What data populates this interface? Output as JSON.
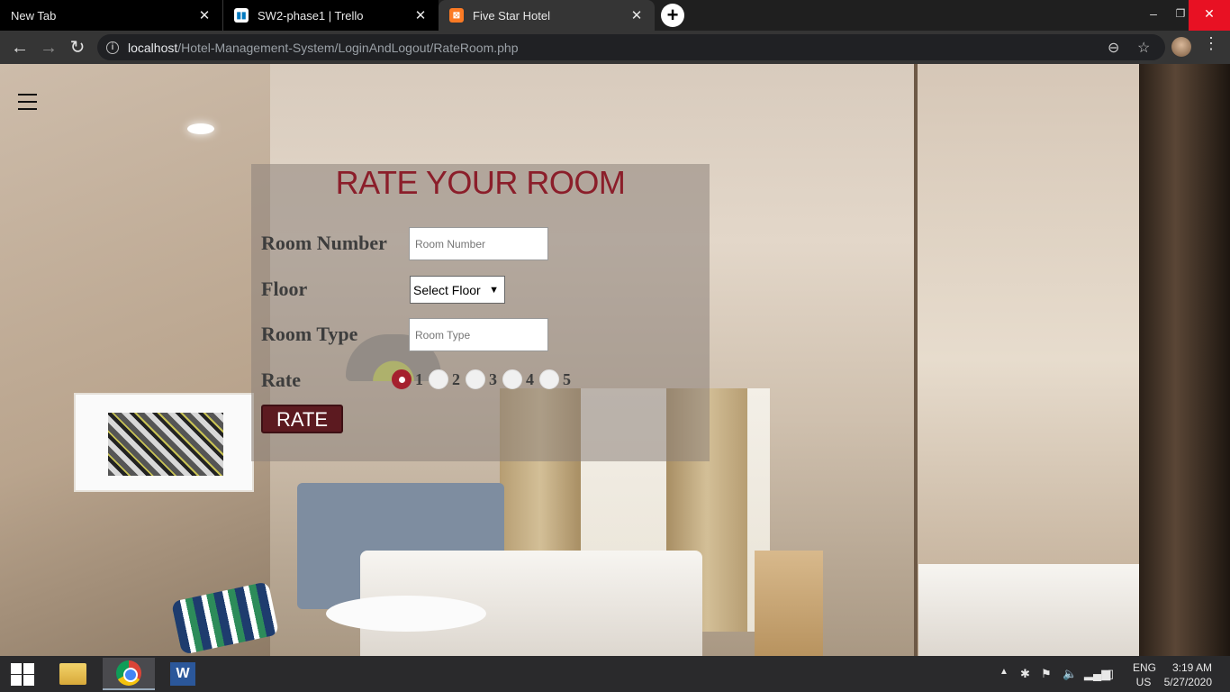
{
  "browser": {
    "tabs": [
      {
        "label": "New Tab",
        "active": false
      },
      {
        "label": "SW2-phase1 | Trello",
        "active": false
      },
      {
        "label": "Five Star Hotel",
        "active": true
      }
    ],
    "close_glyph": "✕",
    "new_tab_glyph": "+",
    "window_controls": {
      "minimize": "–",
      "maximize": "❐",
      "close": "✕"
    },
    "url_host": "localhost",
    "url_path": "/Hotel-Management-System/LoginAndLogout/RateRoom.php",
    "nav": {
      "back": "←",
      "forward": "→",
      "reload": "↻"
    },
    "omni_icons": {
      "zoom": "⊖",
      "star": "☆",
      "menu": "⋮"
    }
  },
  "page": {
    "title": "RATE YOUR ROOM",
    "fields": {
      "room_number": {
        "label": "Room Number",
        "placeholder": "Room Number"
      },
      "floor": {
        "label": "Floor",
        "selected": "Select Floor"
      },
      "room_type": {
        "label": "Room Type",
        "placeholder": "Room Type"
      },
      "rate": {
        "label": "Rate",
        "options": [
          "1",
          "2",
          "3",
          "4",
          "5"
        ],
        "selected": "1"
      }
    },
    "submit_label": "RATE",
    "accent_color": "#8b1e2a",
    "button_color": "#5c1a20"
  },
  "taskbar": {
    "apps": [
      "file-explorer",
      "chrome",
      "word"
    ],
    "word_glyph": "W",
    "language": {
      "line1": "ENG",
      "line2": "US"
    },
    "time": "3:19 AM",
    "date": "5/27/2020"
  }
}
